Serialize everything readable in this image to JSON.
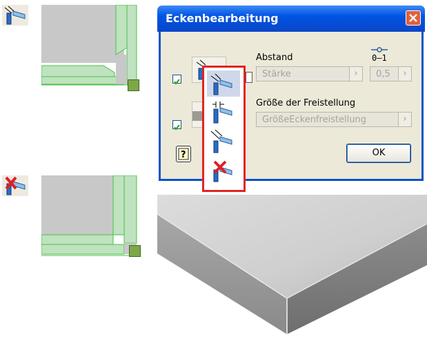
{
  "dialog": {
    "title": "Eckenbearbeitung",
    "abstand_label": "Abstand",
    "abstand_value": "Stärke",
    "abstand_number": "0,5",
    "groesse_label": "Größe der Freistellung",
    "groesse_value": "GrößeEckenfreistellung",
    "ok_label": "OK",
    "checkbox1_checked": true,
    "checkbox2_checked": true
  },
  "colors": {
    "title_bar": "#0054e3",
    "highlight": "#e22424",
    "edge_green": "#38c838"
  }
}
